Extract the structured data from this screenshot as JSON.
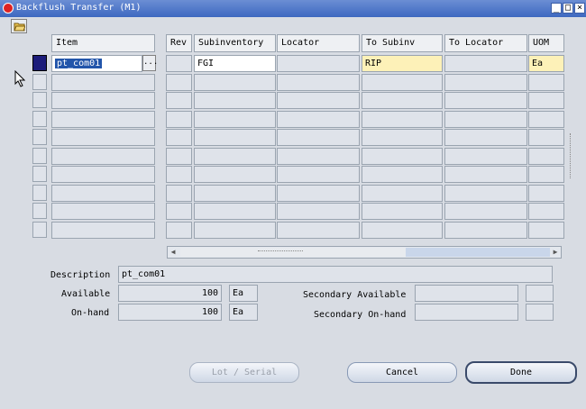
{
  "window": {
    "title": "Backflush Transfer (M1)",
    "minimize_icon": "minimize-icon",
    "maximize_icon": "maximize-icon",
    "close_icon": "close-icon"
  },
  "toolbar": {
    "open_icon": "folder-open-icon"
  },
  "table": {
    "headers": {
      "item": "Item",
      "rev": "Rev",
      "subinventory": "Subinventory",
      "locator": "Locator",
      "to_subinv": "To Subinv",
      "to_locator": "To Locator",
      "uom": "UOM"
    },
    "row1": {
      "item": "pt_com01",
      "rev": "",
      "subinventory": "FGI",
      "locator": "",
      "to_subinv": "RIP",
      "to_locator": "",
      "uom": "Ea"
    },
    "lov_label": "..."
  },
  "details": {
    "description_label": "Description",
    "description_value": "pt_com01",
    "available_label": "Available",
    "available_value": "100",
    "available_uom": "Ea",
    "onhand_label": "On-hand",
    "onhand_value": "100",
    "onhand_uom": "Ea",
    "secondary_available_label": "Secondary Available",
    "secondary_onhand_label": "Secondary On-hand"
  },
  "buttons": {
    "lot_serial": "Lot / Serial",
    "cancel": "Cancel",
    "done": "Done"
  },
  "colors": {
    "title_bar": "#3d68c0",
    "current_record": "#1c1c7a",
    "required_field": "#fdf1b8"
  }
}
